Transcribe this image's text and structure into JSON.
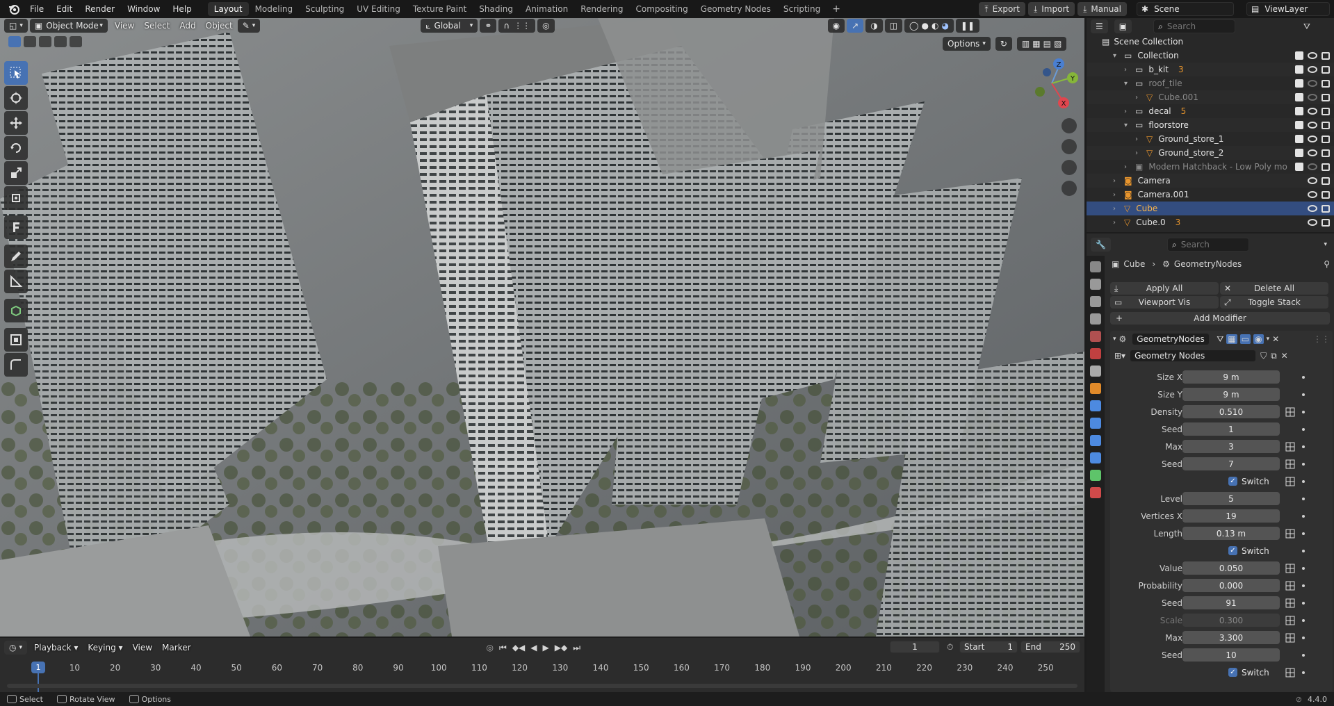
{
  "menu": {
    "file": "File",
    "edit": "Edit",
    "render": "Render",
    "window": "Window",
    "help": "Help"
  },
  "workspaces": [
    "Layout",
    "Modeling",
    "Sculpting",
    "UV Editing",
    "Texture Paint",
    "Shading",
    "Animation",
    "Rendering",
    "Compositing",
    "Geometry Nodes",
    "Scripting"
  ],
  "active_workspace": "Layout",
  "topright": {
    "export": "Export",
    "import": "Import",
    "manual": "Manual",
    "scene": "Scene",
    "viewlayer": "ViewLayer"
  },
  "viewport": {
    "mode": "Object Mode",
    "view": "View",
    "select": "Select",
    "add": "Add",
    "object": "Object",
    "orientation": "Global",
    "options": "Options",
    "gizmo": {
      "x": "X",
      "y": "Y",
      "z": "Z"
    }
  },
  "outliner": {
    "search_placeholder": "Search",
    "root": "Scene Collection",
    "items": [
      {
        "label": "Collection",
        "muted": false
      },
      {
        "label": "b_kit",
        "muted": false,
        "badge": "3"
      },
      {
        "label": "roof_tile",
        "muted": true
      },
      {
        "label": "Cube.001",
        "muted": true
      },
      {
        "label": "decal",
        "muted": false,
        "badge": "5"
      },
      {
        "label": "floorstore",
        "muted": false
      },
      {
        "label": "Ground_store_1",
        "muted": false
      },
      {
        "label": "Ground_store_2",
        "muted": false
      },
      {
        "label": "Modern Hatchback - Low Poly mo",
        "muted": true
      },
      {
        "label": "Camera",
        "muted": false
      },
      {
        "label": "Camera.001",
        "muted": false
      },
      {
        "label": "Cube",
        "muted": false,
        "selected": true
      },
      {
        "label": "Cube.0",
        "muted": false,
        "badge": "3"
      }
    ]
  },
  "properties": {
    "search_placeholder": "Search",
    "breadcrumb_object": "Cube",
    "breadcrumb_modifier": "GeometryNodes",
    "apply_all": "Apply All",
    "delete_all": "Delete All",
    "viewport_vis": "Viewport Vis",
    "toggle_stack": "Toggle Stack",
    "add_modifier": "Add Modifier",
    "modifier_name": "GeometryNodes",
    "node_group": "Geometry Nodes",
    "fields": [
      {
        "label": "Size X",
        "value": "9 m",
        "kind": "value",
        "sock": false
      },
      {
        "label": "Size Y",
        "value": "9 m",
        "kind": "value",
        "sock": false
      },
      {
        "label": "Density",
        "value": "0.510",
        "kind": "value",
        "sock": true
      },
      {
        "label": "Seed",
        "value": "1",
        "kind": "value",
        "sock": false
      },
      {
        "label": "Max",
        "value": "3",
        "kind": "value",
        "sock": true
      },
      {
        "label": "Seed",
        "value": "7",
        "kind": "value",
        "sock": true
      },
      {
        "label": "",
        "value": "Switch",
        "kind": "check",
        "sock": true
      },
      {
        "label": "Level",
        "value": "5",
        "kind": "value",
        "sock": false
      },
      {
        "label": "Vertices X",
        "value": "19",
        "kind": "value",
        "sock": false
      },
      {
        "label": "Length",
        "value": "0.13 m",
        "kind": "value",
        "sock": true
      },
      {
        "label": "",
        "value": "Switch",
        "kind": "check",
        "sock": false
      },
      {
        "label": "Value",
        "value": "0.050",
        "kind": "value",
        "sock": true
      },
      {
        "label": "Probability",
        "value": "0.000",
        "kind": "value",
        "sock": true
      },
      {
        "label": "Seed",
        "value": "91",
        "kind": "value",
        "sock": true
      },
      {
        "label": "Scale",
        "value": "0.300",
        "kind": "dim",
        "sock": true
      },
      {
        "label": "Max",
        "value": "3.300",
        "kind": "value",
        "sock": true
      },
      {
        "label": "Seed",
        "value": "10",
        "kind": "value",
        "sock": false
      },
      {
        "label": "",
        "value": "Switch",
        "kind": "check",
        "sock": true
      }
    ]
  },
  "timeline": {
    "playback": "Playback",
    "keying": "Keying",
    "view": "View",
    "marker": "Marker",
    "current_frame": "1",
    "start_label": "Start",
    "start": "1",
    "end_label": "End",
    "end": "250",
    "ticks": [
      "10",
      "20",
      "30",
      "40",
      "50",
      "60",
      "70",
      "80",
      "90",
      "100",
      "110",
      "120",
      "130",
      "140",
      "150",
      "160",
      "170",
      "180",
      "190",
      "200",
      "210",
      "220",
      "230",
      "240",
      "250"
    ]
  },
  "statusbar": {
    "select": "Select",
    "rotate": "Rotate View",
    "options": "Options",
    "version": "4.4.0"
  }
}
